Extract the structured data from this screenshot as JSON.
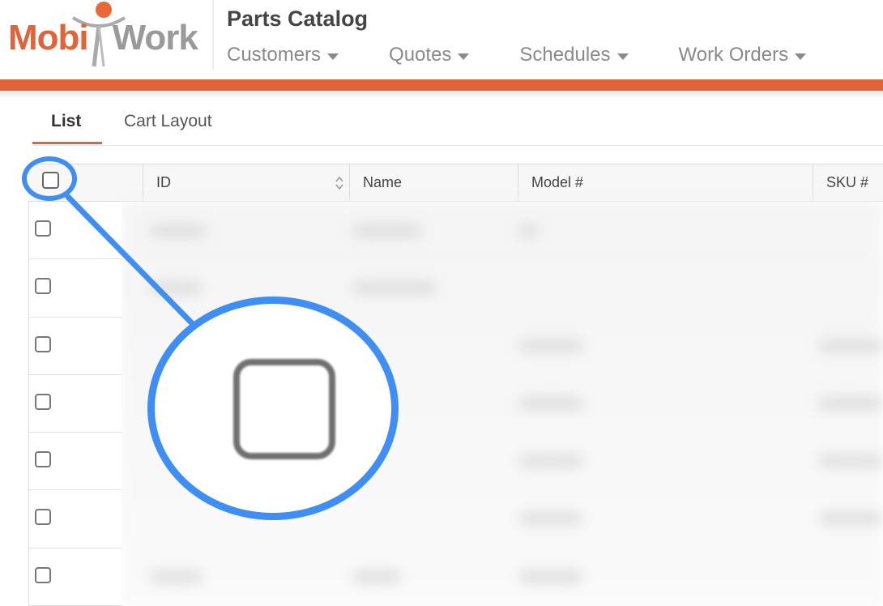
{
  "logo": {
    "part1": "Mobi",
    "part2": "Work"
  },
  "header": {
    "title": "Parts Catalog"
  },
  "nav": [
    {
      "label": "Customers"
    },
    {
      "label": "Quotes"
    },
    {
      "label": "Schedules"
    },
    {
      "label": "Work Orders"
    }
  ],
  "tabs": {
    "list": "List",
    "cart": "Cart Layout"
  },
  "table": {
    "columns": {
      "id": "ID",
      "name": "Name",
      "model": "Model #",
      "sku": "SKU #"
    },
    "row_count": 7
  },
  "colors": {
    "accent": "#e0643a",
    "callout": "#3f8ef3"
  },
  "icons": {
    "sort": "sort-icon",
    "caret": "chevron-down-icon"
  }
}
